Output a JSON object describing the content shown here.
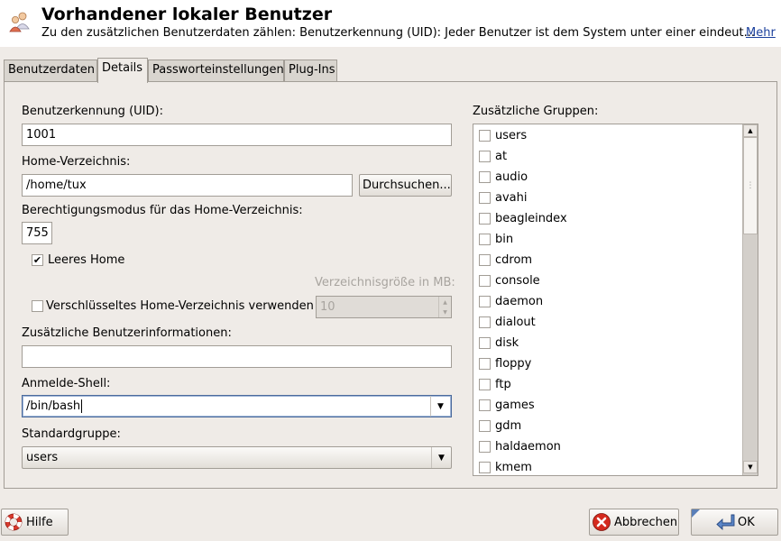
{
  "header": {
    "title": "Vorhandener lokaler Benutzer",
    "description": "Zu den zusätzlichen Benutzerdaten zählen: Benutzerkennung (UID): Jeder Benutzer ist dem System unter einer eindeut...",
    "more_link": "Mehr",
    "icon": "users-icon"
  },
  "tabs": [
    {
      "label": "Benutzerdaten",
      "active": false
    },
    {
      "label": "Details",
      "active": true
    },
    {
      "label": "Passworteinstellungen",
      "active": false
    },
    {
      "label": "Plug-Ins",
      "active": false
    }
  ],
  "details": {
    "uid_label": "Benutzerkennung (UID):",
    "uid_value": "1001",
    "home_label": "Home-Verzeichnis:",
    "home_value": "/home/tux",
    "browse_button": "Durchsuchen...",
    "perm_label": "Berechtigungsmodus für das Home-Verzeichnis:",
    "perm_value": "755",
    "empty_home_label": "Leeres Home",
    "empty_home_checked": true,
    "dir_size_label": "Verzeichnisgröße in MB:",
    "dir_size_value": "10",
    "encrypted_home_label": "Verschlüsseltes Home-Verzeichnis verwenden",
    "encrypted_home_checked": false,
    "extra_info_label": "Zusätzliche Benutzerinformationen:",
    "extra_info_value": "",
    "shell_label": "Anmelde-Shell:",
    "shell_value": "/bin/bash",
    "default_group_label": "Standardgruppe:",
    "default_group_value": "users"
  },
  "groups": {
    "label": "Zusätzliche Gruppen:",
    "items": [
      "users",
      "at",
      "audio",
      "avahi",
      "beagleindex",
      "bin",
      "cdrom",
      "console",
      "daemon",
      "dialout",
      "disk",
      "floppy",
      "ftp",
      "games",
      "gdm",
      "haldaemon",
      "kmem"
    ]
  },
  "buttons": {
    "help": "Hilfe",
    "cancel": "Abbrechen",
    "ok": "OK"
  },
  "colors": {
    "background": "#efebe7",
    "link": "#1a3f9c",
    "border": "#a29d96"
  }
}
